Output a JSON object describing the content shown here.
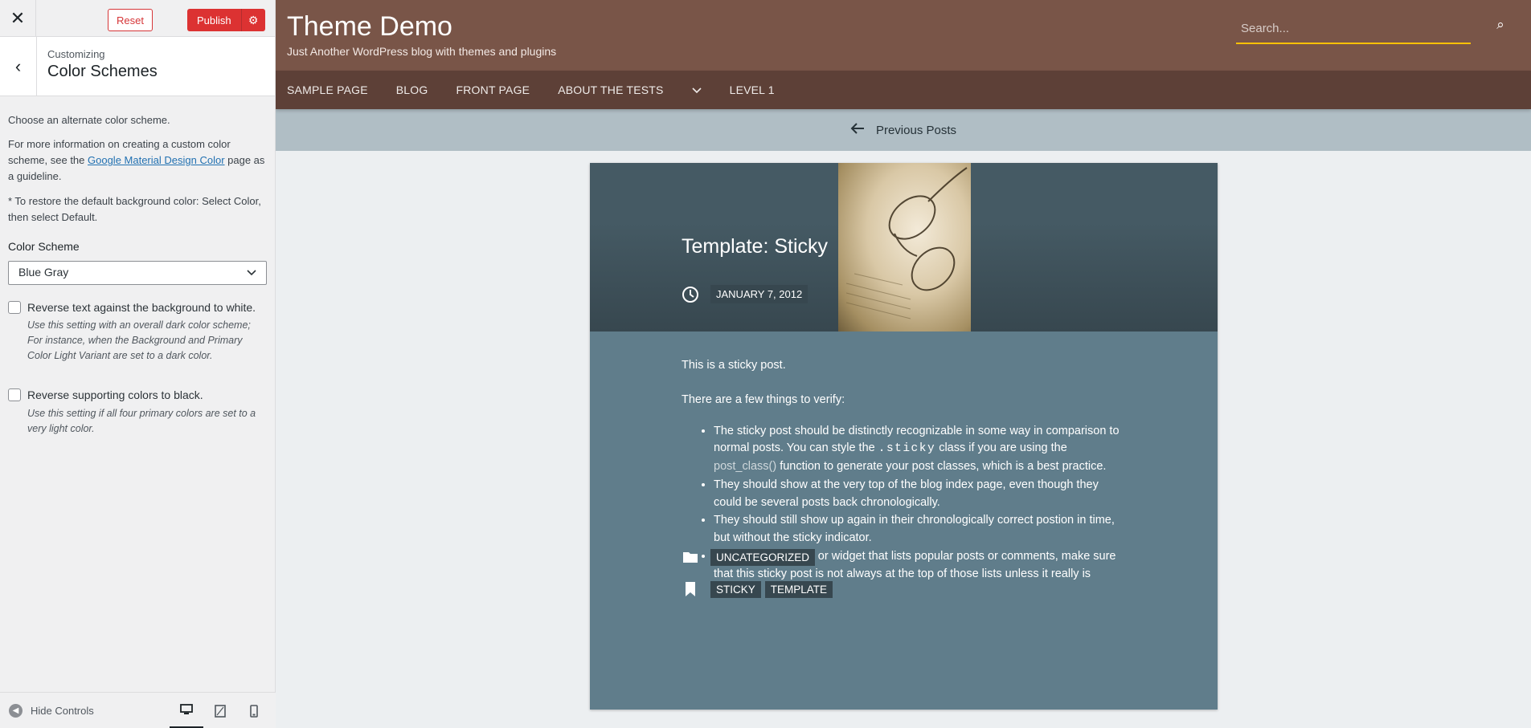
{
  "customizer": {
    "close_icon": "close-icon",
    "reset_label": "Reset",
    "publish_label": "Publish",
    "settings_icon": "gear-icon",
    "customizing_label": "Customizing",
    "section_title": "Color Schemes",
    "intro": "Choose an alternate color scheme.",
    "info_before": "For more information on creating a custom color scheme, see the ",
    "info_link": "Google Material Design Color",
    "info_after": " page as a guideline.",
    "restore_note": "* To restore the default background color: Select Color, then select Default.",
    "scheme_label": "Color Scheme",
    "scheme_value": "Blue Gray",
    "reverse_white_label": "Reverse text against the background to white.",
    "reverse_white_desc": "Use this setting with an overall dark color scheme; For instance, when the Background and Primary Color Light Variant are set to a dark color.",
    "reverse_black_label": "Reverse supporting colors to black.",
    "reverse_black_desc": "Use this setting if all four primary colors are set to a very light color.",
    "hide_controls_label": "Hide Controls",
    "devices": [
      "desktop",
      "tablet",
      "mobile"
    ]
  },
  "site": {
    "title": "Theme Demo",
    "tagline": "Just Another WordPress blog with themes and plugins",
    "search_placeholder": "Search...",
    "nav": {
      "sample_page": "SAMPLE PAGE",
      "blog": "BLOG",
      "front_page": "FRONT PAGE",
      "about_the_tests": "ABOUT THE TESTS",
      "level_1": "LEVEL 1"
    },
    "previous_posts": "Previous Posts"
  },
  "post": {
    "title": "Template: Sticky",
    "date": "JANUARY 7, 2012",
    "intro": "This is a sticky post.",
    "verify_intro": "There are a few things to verify:",
    "bullet1_before": "The sticky post should be distinctly recognizable in some way in comparison to normal posts. You can style the ",
    "bullet1_code": ".sticky",
    "bullet1_middle": " class if you are using the ",
    "bullet1_func": "post_class()",
    "bullet1_after": " function to generate your post classes, which is a best practice.",
    "bullet2": "They should show at the very top of the blog index page, even though they could be several posts back chronologically.",
    "bullet3": "They should still show up again in their chronologically correct postion in time, but without the sticky indicator.",
    "bullet4": "If you have a plugin or widget that lists popular posts or comments, make sure that this sticky post is not always at the top of those lists unless it really is popular.",
    "category": "UNCATEGORIZED",
    "tags": [
      "STICKY",
      "TEMPLATE"
    ]
  },
  "colors": {
    "header_brown": "#795548",
    "nav_brown": "#5d4037",
    "post_bluegray": "#607d8b",
    "chip_dark": "#37474f",
    "publish_red": "#dc3232",
    "search_underline": "#ffc107"
  }
}
